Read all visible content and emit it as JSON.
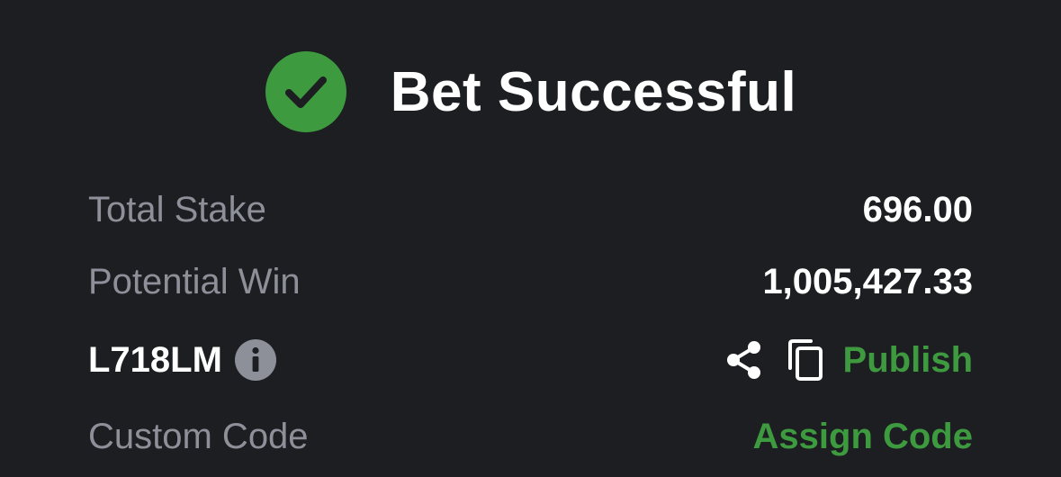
{
  "header": {
    "title": "Bet Successful",
    "icon": "check-circle-icon",
    "icon_color": "#3e9a3f"
  },
  "summary": {
    "total_stake_label": "Total Stake",
    "total_stake_value": "696.00",
    "potential_win_label": "Potential Win",
    "potential_win_value": "1,005,427.33"
  },
  "booking": {
    "code": "L718LM",
    "info_icon": "info-icon",
    "share_icon": "share-icon",
    "copy_icon": "copy-icon",
    "publish_label": "Publish"
  },
  "custom_code": {
    "label": "Custom Code",
    "action_label": "Assign Code"
  },
  "colors": {
    "background": "#1d1e22",
    "accent": "#3e9a3f",
    "muted_text": "#8e9099",
    "primary_text": "#ffffff"
  }
}
